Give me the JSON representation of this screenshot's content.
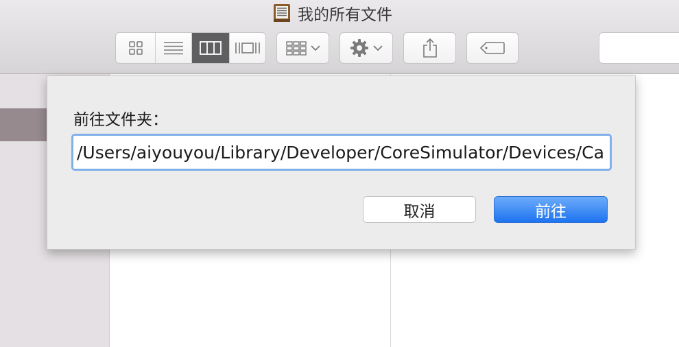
{
  "window": {
    "title": "我的所有文件",
    "title_icon": "cabinet-drawer-icon"
  },
  "toolbar": {
    "view_modes": [
      "icon-view-icon",
      "list-view-icon",
      "column-view-icon",
      "cover-flow-icon"
    ],
    "active_view": "column-view",
    "arrange_icon": "arrange-grid-icon",
    "action_icon": "gear-icon",
    "share_icon": "share-icon",
    "tag_icon": "tag-icon"
  },
  "dialog": {
    "label": "前往文件夹：",
    "path_value": "/Users/aiyouyou/Library/Developer/CoreSimulator/Devices/Ca",
    "cancel_label": "取消",
    "go_label": "前往"
  },
  "colors": {
    "accent": "#1e73f0",
    "focus_ring": "#7fb0ec",
    "sidebar_selection": "#978a8f"
  }
}
